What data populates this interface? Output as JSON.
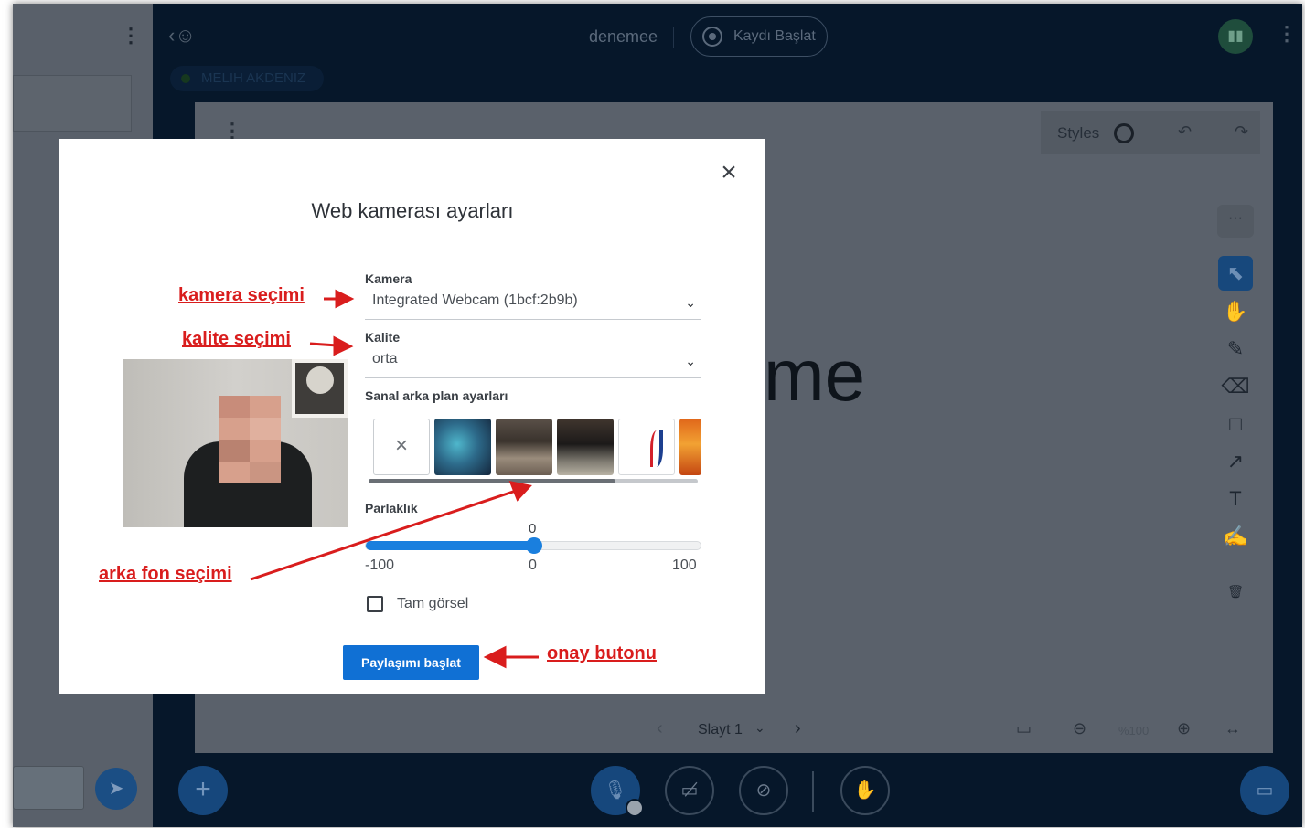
{
  "header": {
    "meeting_name": "denemee",
    "record_label": "Kaydı Başlat",
    "presenter_name": "MELIH AKDENIZ"
  },
  "whiteboard": {
    "styles_label": "Styles",
    "slide_text": "me",
    "slide_label": "Slayt 1",
    "zoom_value": "%100"
  },
  "modal": {
    "title": "Web kamerası ayarları",
    "camera_label": "Kamera",
    "camera_value": "Integrated Webcam (1bcf:2b9b)",
    "quality_label": "Kalite",
    "quality_value": "orta",
    "background_label": "Sanal arka plan ayarları",
    "brightness_label": "Parlaklık",
    "brightness": {
      "min": -100,
      "max": 100,
      "value": 0,
      "min_label": "-100",
      "mid_label": "0",
      "max_label": "100",
      "value_label": "0"
    },
    "full_image_label": "Tam görsel",
    "full_image_checked": false,
    "confirm_label": "Paylaşımı başlat"
  },
  "annotations": {
    "camera": "kamera seçimi",
    "quality": "kalite seçimi",
    "background": "arka fon seçimi",
    "confirm": "onay butonu",
    "color": "#d91d1d"
  },
  "icons": {
    "close": "close-icon",
    "chevron": "chevron-down-icon",
    "record": "record-icon",
    "send": "send-icon"
  }
}
